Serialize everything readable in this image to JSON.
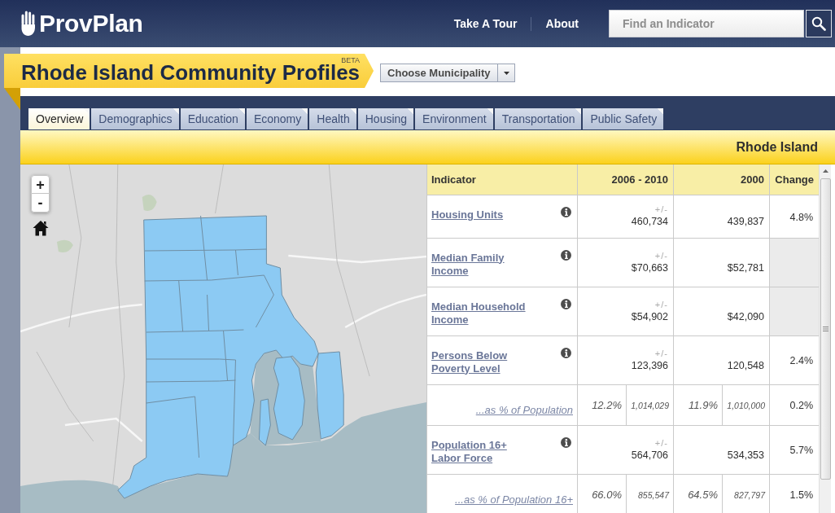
{
  "header": {
    "logo": "ProvPlan",
    "nav": [
      "Take A Tour",
      "About"
    ],
    "search": {
      "placeholder": "Find an Indicator"
    }
  },
  "banner": {
    "title": "Rhode Island Community Profiles",
    "badge": "BETA"
  },
  "municipality_select": {
    "label": "Choose Municipality"
  },
  "tabs": [
    {
      "label": "Overview",
      "selected": true
    },
    {
      "label": "Demographics",
      "selected": false
    },
    {
      "label": "Education",
      "selected": false
    },
    {
      "label": "Economy",
      "selected": false
    },
    {
      "label": "Health",
      "selected": false
    },
    {
      "label": "Housing",
      "selected": false
    },
    {
      "label": "Environment",
      "selected": false
    },
    {
      "label": "Transportation",
      "selected": false
    },
    {
      "label": "Public Safety",
      "selected": false
    }
  ],
  "region_bar": {
    "title": "Rhode Island"
  },
  "map": {
    "zoom_in": "+",
    "zoom_out": "-"
  },
  "table": {
    "columns": [
      "Indicator",
      "2006 - 2010",
      "2000",
      "Change"
    ],
    "rows": [
      {
        "kind": "indicator",
        "label": "Housing Units",
        "margin_label": "+/-",
        "estimate": "460,734",
        "value_2000": "439,837",
        "change": "4.8%"
      },
      {
        "kind": "indicator",
        "label": "Median Family Income",
        "margin_label": "+/-",
        "estimate": "$70,663",
        "value_2000": "$52,781"
      },
      {
        "kind": "indicator",
        "label": "Median Household Income",
        "margin_label": "+/-",
        "estimate": "$54,902",
        "value_2000": "$42,090"
      },
      {
        "kind": "indicator",
        "label": "Persons Below Poverty Level",
        "margin_label": "+/-",
        "estimate": "123,396",
        "value_2000": "120,548",
        "change": "2.4%"
      },
      {
        "kind": "share",
        "label": "...as % of Population",
        "share_2010": "12.2%",
        "base_2010": "1,014,029",
        "share_2000": "11.9%",
        "base_2000": "1,010,000",
        "change": "0.2%"
      },
      {
        "kind": "indicator",
        "label": "Population 16+ Labor Force",
        "margin_label": "+/-",
        "estimate": "564,706",
        "value_2000": "534,353",
        "change": "5.7%"
      },
      {
        "kind": "share",
        "label": "...as % of Population 16+",
        "share_2010": "66.0%",
        "base_2010": "855,547",
        "share_2000": "64.5%",
        "base_2000": "827,797",
        "change": "1.5%"
      }
    ]
  }
}
